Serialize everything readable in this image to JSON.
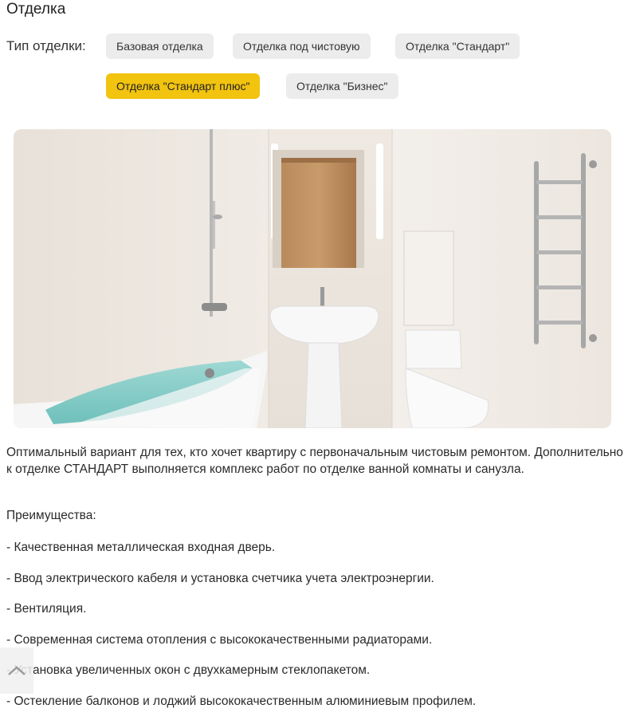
{
  "header": {
    "title": "Отделка"
  },
  "finish": {
    "label": "Тип отделки:",
    "options": [
      {
        "label": "Базовая отделка"
      },
      {
        "label": "Отделка под чистовую"
      },
      {
        "label": "Отделка \"Стандарт\""
      },
      {
        "label": "Отделка \"Стандарт плюс\""
      },
      {
        "label": "Отделка \"Бизнес\""
      }
    ],
    "selected": "Отделка \"Стандарт плюс\""
  },
  "colors": {
    "accent": "#f2c30f",
    "chip": "#ececec"
  },
  "description": "Оптимальный вариант для тех, кто хочет квартиру с первоначальным чистовым ремонтом. Дополнительно к отделке СТАНДАРТ выполняется комплекс работ по отделке ванной комнаты и санузла.",
  "advantages": {
    "title": "Преимущества:",
    "items": [
      "- Качественная металлическая входная дверь.",
      "- Ввод электрического кабеля и установка счетчика учета электроэнергии.",
      "- Вентиляция.",
      "- Современная система отопления с высококачественными радиаторами.",
      "- Установка увеличенных окон с двухкамерным стеклопакетом.",
      "- Остекление балконов и лоджий высококачественным алюминиевым профилем."
    ]
  },
  "icons": {
    "scroll_top": "chevron-up-icon"
  }
}
